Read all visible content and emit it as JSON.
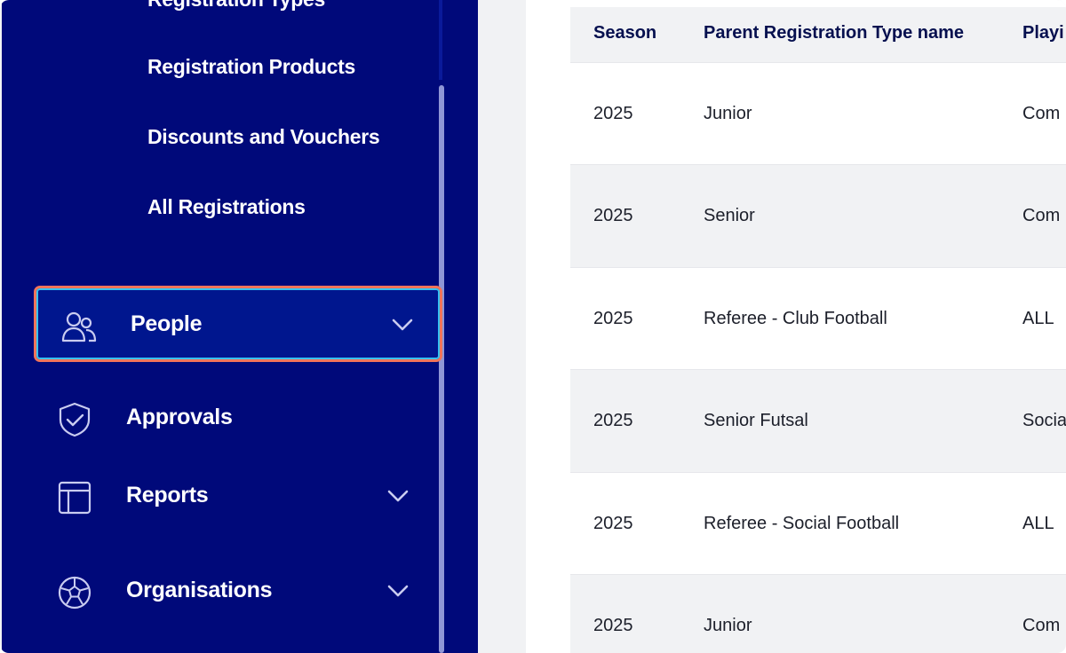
{
  "sidebar": {
    "sub_items": [
      "Registration Types",
      "Registration Products",
      "Discounts and Vouchers",
      "All Registrations"
    ],
    "nav": {
      "people": "People",
      "approvals": "Approvals",
      "reports": "Reports",
      "organisations": "Organisations"
    }
  },
  "table": {
    "headers": [
      "Season",
      "Parent Registration Type name",
      "Playi"
    ],
    "rows": [
      [
        "2025",
        "Junior",
        "Com"
      ],
      [
        "2025",
        "Senior",
        "Com"
      ],
      [
        "2025",
        "Referee - Club Football",
        "ALL"
      ],
      [
        "2025",
        "Senior Futsal",
        "Socia"
      ],
      [
        "2025",
        "Referee - Social Football",
        "ALL"
      ],
      [
        "2025",
        "Junior",
        "Com"
      ]
    ]
  },
  "colors": {
    "sidebar_bg": "#00097a",
    "active_outline": "#f0745a",
    "focus_ring": "#36c1f0"
  }
}
